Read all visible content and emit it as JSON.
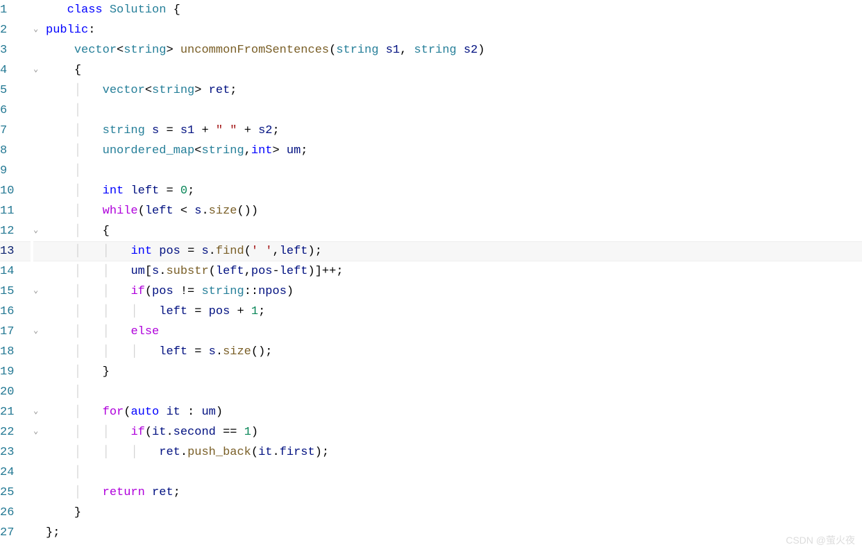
{
  "lines": [
    {
      "n": "1",
      "fold": "",
      "code": [
        [
          "",
          "   "
        ],
        [
          "kw-blue",
          "class"
        ],
        [
          "",
          " "
        ],
        [
          "type",
          "Solution"
        ],
        [
          "",
          " {"
        ]
      ]
    },
    {
      "n": "2",
      "fold": "v",
      "code": [
        [
          "kw-blue",
          "public"
        ],
        [
          "punct",
          ":"
        ]
      ]
    },
    {
      "n": "3",
      "fold": "",
      "code": [
        [
          "",
          "    "
        ],
        [
          "type",
          "vector"
        ],
        [
          "punct",
          "<"
        ],
        [
          "type",
          "string"
        ],
        [
          "punct",
          "> "
        ],
        [
          "func",
          "uncommonFromSentences"
        ],
        [
          "punct",
          "("
        ],
        [
          "type",
          "string"
        ],
        [
          "",
          " "
        ],
        [
          "ident",
          "s1"
        ],
        [
          "punct",
          ", "
        ],
        [
          "type",
          "string"
        ],
        [
          "",
          " "
        ],
        [
          "ident",
          "s2"
        ],
        [
          "punct",
          ")"
        ]
      ]
    },
    {
      "n": "4",
      "fold": "v",
      "code": [
        [
          "",
          "    "
        ],
        [
          "punct",
          "{"
        ]
      ]
    },
    {
      "n": "5",
      "fold": "",
      "code": [
        [
          "",
          "    "
        ],
        [
          "guide",
          "│"
        ],
        [
          "",
          "   "
        ],
        [
          "type",
          "vector"
        ],
        [
          "punct",
          "<"
        ],
        [
          "type",
          "string"
        ],
        [
          "punct",
          "> "
        ],
        [
          "ident",
          "ret"
        ],
        [
          "punct",
          ";"
        ]
      ]
    },
    {
      "n": "6",
      "fold": "",
      "code": [
        [
          "",
          "    "
        ],
        [
          "guide",
          "│"
        ]
      ]
    },
    {
      "n": "7",
      "fold": "",
      "code": [
        [
          "",
          "    "
        ],
        [
          "guide",
          "│"
        ],
        [
          "",
          "   "
        ],
        [
          "type",
          "string"
        ],
        [
          "",
          " "
        ],
        [
          "ident",
          "s"
        ],
        [
          "",
          " "
        ],
        [
          "op",
          "="
        ],
        [
          "",
          " "
        ],
        [
          "ident",
          "s1"
        ],
        [
          "",
          " "
        ],
        [
          "op",
          "+"
        ],
        [
          "",
          " "
        ],
        [
          "str",
          "\" \""
        ],
        [
          "",
          " "
        ],
        [
          "op",
          "+"
        ],
        [
          "",
          " "
        ],
        [
          "ident",
          "s2"
        ],
        [
          "punct",
          ";"
        ]
      ]
    },
    {
      "n": "8",
      "fold": "",
      "code": [
        [
          "",
          "    "
        ],
        [
          "guide",
          "│"
        ],
        [
          "",
          "   "
        ],
        [
          "type",
          "unordered_map"
        ],
        [
          "punct",
          "<"
        ],
        [
          "type",
          "string"
        ],
        [
          "punct",
          ","
        ],
        [
          "kw-blue",
          "int"
        ],
        [
          "punct",
          "> "
        ],
        [
          "ident",
          "um"
        ],
        [
          "punct",
          ";"
        ]
      ]
    },
    {
      "n": "9",
      "fold": "",
      "code": [
        [
          "",
          "    "
        ],
        [
          "guide",
          "│"
        ]
      ]
    },
    {
      "n": "10",
      "fold": "",
      "code": [
        [
          "",
          "    "
        ],
        [
          "guide",
          "│"
        ],
        [
          "",
          "   "
        ],
        [
          "kw-blue",
          "int"
        ],
        [
          "",
          " "
        ],
        [
          "ident",
          "left"
        ],
        [
          "",
          " "
        ],
        [
          "op",
          "="
        ],
        [
          "",
          " "
        ],
        [
          "num",
          "0"
        ],
        [
          "punct",
          ";"
        ]
      ]
    },
    {
      "n": "11",
      "fold": "",
      "code": [
        [
          "",
          "    "
        ],
        [
          "guide",
          "│"
        ],
        [
          "",
          "   "
        ],
        [
          "kw-purple",
          "while"
        ],
        [
          "punct",
          "("
        ],
        [
          "ident",
          "left"
        ],
        [
          "",
          " "
        ],
        [
          "op",
          "<"
        ],
        [
          "",
          " "
        ],
        [
          "ident",
          "s"
        ],
        [
          "punct",
          "."
        ],
        [
          "func",
          "size"
        ],
        [
          "punct",
          "())"
        ]
      ]
    },
    {
      "n": "12",
      "fold": "v",
      "code": [
        [
          "",
          "    "
        ],
        [
          "guide",
          "│"
        ],
        [
          "",
          "   "
        ],
        [
          "punct",
          "{"
        ]
      ]
    },
    {
      "n": "13",
      "fold": "",
      "hl": true,
      "code": [
        [
          "",
          "    "
        ],
        [
          "guide",
          "│"
        ],
        [
          "",
          "   "
        ],
        [
          "guide",
          "│"
        ],
        [
          "",
          "   "
        ],
        [
          "kw-blue",
          "int"
        ],
        [
          "",
          " "
        ],
        [
          "ident",
          "pos"
        ],
        [
          "",
          " "
        ],
        [
          "op",
          "="
        ],
        [
          "",
          " "
        ],
        [
          "ident",
          "s"
        ],
        [
          "punct",
          "."
        ],
        [
          "func",
          "find"
        ],
        [
          "punct",
          "("
        ],
        [
          "str",
          "' '"
        ],
        [
          "punct",
          ","
        ],
        [
          "ident",
          "left"
        ],
        [
          "punct",
          ");"
        ]
      ]
    },
    {
      "n": "14",
      "fold": "",
      "code": [
        [
          "",
          "    "
        ],
        [
          "guide",
          "│"
        ],
        [
          "",
          "   "
        ],
        [
          "guide",
          "│"
        ],
        [
          "",
          "   "
        ],
        [
          "ident",
          "um"
        ],
        [
          "punct",
          "["
        ],
        [
          "ident",
          "s"
        ],
        [
          "punct",
          "."
        ],
        [
          "func",
          "substr"
        ],
        [
          "punct",
          "("
        ],
        [
          "ident",
          "left"
        ],
        [
          "punct",
          ","
        ],
        [
          "ident",
          "pos"
        ],
        [
          "op",
          "-"
        ],
        [
          "ident",
          "left"
        ],
        [
          "punct",
          ")]++;"
        ]
      ]
    },
    {
      "n": "15",
      "fold": "v",
      "code": [
        [
          "",
          "    "
        ],
        [
          "guide",
          "│"
        ],
        [
          "",
          "   "
        ],
        [
          "guide",
          "│"
        ],
        [
          "",
          "   "
        ],
        [
          "kw-purple",
          "if"
        ],
        [
          "punct",
          "("
        ],
        [
          "ident",
          "pos"
        ],
        [
          "",
          " "
        ],
        [
          "op",
          "!="
        ],
        [
          "",
          " "
        ],
        [
          "type",
          "string"
        ],
        [
          "punct",
          "::"
        ],
        [
          "ident",
          "npos"
        ],
        [
          "punct",
          ")"
        ]
      ]
    },
    {
      "n": "16",
      "fold": "",
      "code": [
        [
          "",
          "    "
        ],
        [
          "guide",
          "│"
        ],
        [
          "",
          "   "
        ],
        [
          "guide",
          "│"
        ],
        [
          "",
          "   "
        ],
        [
          "guide",
          "│"
        ],
        [
          "",
          "   "
        ],
        [
          "ident",
          "left"
        ],
        [
          "",
          " "
        ],
        [
          "op",
          "="
        ],
        [
          "",
          " "
        ],
        [
          "ident",
          "pos"
        ],
        [
          "",
          " "
        ],
        [
          "op",
          "+"
        ],
        [
          "",
          " "
        ],
        [
          "num",
          "1"
        ],
        [
          "punct",
          ";"
        ]
      ]
    },
    {
      "n": "17",
      "fold": "v",
      "code": [
        [
          "",
          "    "
        ],
        [
          "guide",
          "│"
        ],
        [
          "",
          "   "
        ],
        [
          "guide",
          "│"
        ],
        [
          "",
          "   "
        ],
        [
          "kw-purple",
          "else"
        ]
      ]
    },
    {
      "n": "18",
      "fold": "",
      "code": [
        [
          "",
          "    "
        ],
        [
          "guide",
          "│"
        ],
        [
          "",
          "   "
        ],
        [
          "guide",
          "│"
        ],
        [
          "",
          "   "
        ],
        [
          "guide",
          "│"
        ],
        [
          "",
          "   "
        ],
        [
          "ident",
          "left"
        ],
        [
          "",
          " "
        ],
        [
          "op",
          "="
        ],
        [
          "",
          " "
        ],
        [
          "ident",
          "s"
        ],
        [
          "punct",
          "."
        ],
        [
          "func",
          "size"
        ],
        [
          "punct",
          "();"
        ]
      ]
    },
    {
      "n": "19",
      "fold": "",
      "code": [
        [
          "",
          "    "
        ],
        [
          "guide",
          "│"
        ],
        [
          "",
          "   "
        ],
        [
          "punct",
          "}"
        ]
      ]
    },
    {
      "n": "20",
      "fold": "",
      "code": [
        [
          "",
          "    "
        ],
        [
          "guide",
          "│"
        ]
      ]
    },
    {
      "n": "21",
      "fold": "v",
      "code": [
        [
          "",
          "    "
        ],
        [
          "guide",
          "│"
        ],
        [
          "",
          "   "
        ],
        [
          "kw-purple",
          "for"
        ],
        [
          "punct",
          "("
        ],
        [
          "kw-blue",
          "auto"
        ],
        [
          "",
          " "
        ],
        [
          "ident",
          "it"
        ],
        [
          "",
          " : "
        ],
        [
          "ident",
          "um"
        ],
        [
          "punct",
          ")"
        ]
      ]
    },
    {
      "n": "22",
      "fold": "v",
      "code": [
        [
          "",
          "    "
        ],
        [
          "guide",
          "│"
        ],
        [
          "",
          "   "
        ],
        [
          "guide",
          "│"
        ],
        [
          "",
          "   "
        ],
        [
          "kw-purple",
          "if"
        ],
        [
          "punct",
          "("
        ],
        [
          "ident",
          "it"
        ],
        [
          "punct",
          "."
        ],
        [
          "ident",
          "second"
        ],
        [
          "",
          " "
        ],
        [
          "op",
          "=="
        ],
        [
          "",
          " "
        ],
        [
          "num",
          "1"
        ],
        [
          "punct",
          ")"
        ]
      ]
    },
    {
      "n": "23",
      "fold": "",
      "code": [
        [
          "",
          "    "
        ],
        [
          "guide",
          "│"
        ],
        [
          "",
          "   "
        ],
        [
          "guide",
          "│"
        ],
        [
          "",
          "   "
        ],
        [
          "guide",
          "│"
        ],
        [
          "",
          "   "
        ],
        [
          "ident",
          "ret"
        ],
        [
          "punct",
          "."
        ],
        [
          "func",
          "push_back"
        ],
        [
          "punct",
          "("
        ],
        [
          "ident",
          "it"
        ],
        [
          "punct",
          "."
        ],
        [
          "ident",
          "first"
        ],
        [
          "punct",
          ");"
        ]
      ]
    },
    {
      "n": "24",
      "fold": "",
      "code": [
        [
          "",
          "    "
        ],
        [
          "guide",
          "│"
        ]
      ]
    },
    {
      "n": "25",
      "fold": "",
      "code": [
        [
          "",
          "    "
        ],
        [
          "guide",
          "│"
        ],
        [
          "",
          "   "
        ],
        [
          "kw-purple",
          "return"
        ],
        [
          "",
          " "
        ],
        [
          "ident",
          "ret"
        ],
        [
          "punct",
          ";"
        ]
      ]
    },
    {
      "n": "26",
      "fold": "",
      "code": [
        [
          "",
          "    "
        ],
        [
          "punct",
          "}"
        ]
      ]
    },
    {
      "n": "27",
      "fold": "",
      "code": [
        [
          "punct",
          "};"
        ]
      ]
    }
  ],
  "watermark": "CSDN @萤火夜"
}
